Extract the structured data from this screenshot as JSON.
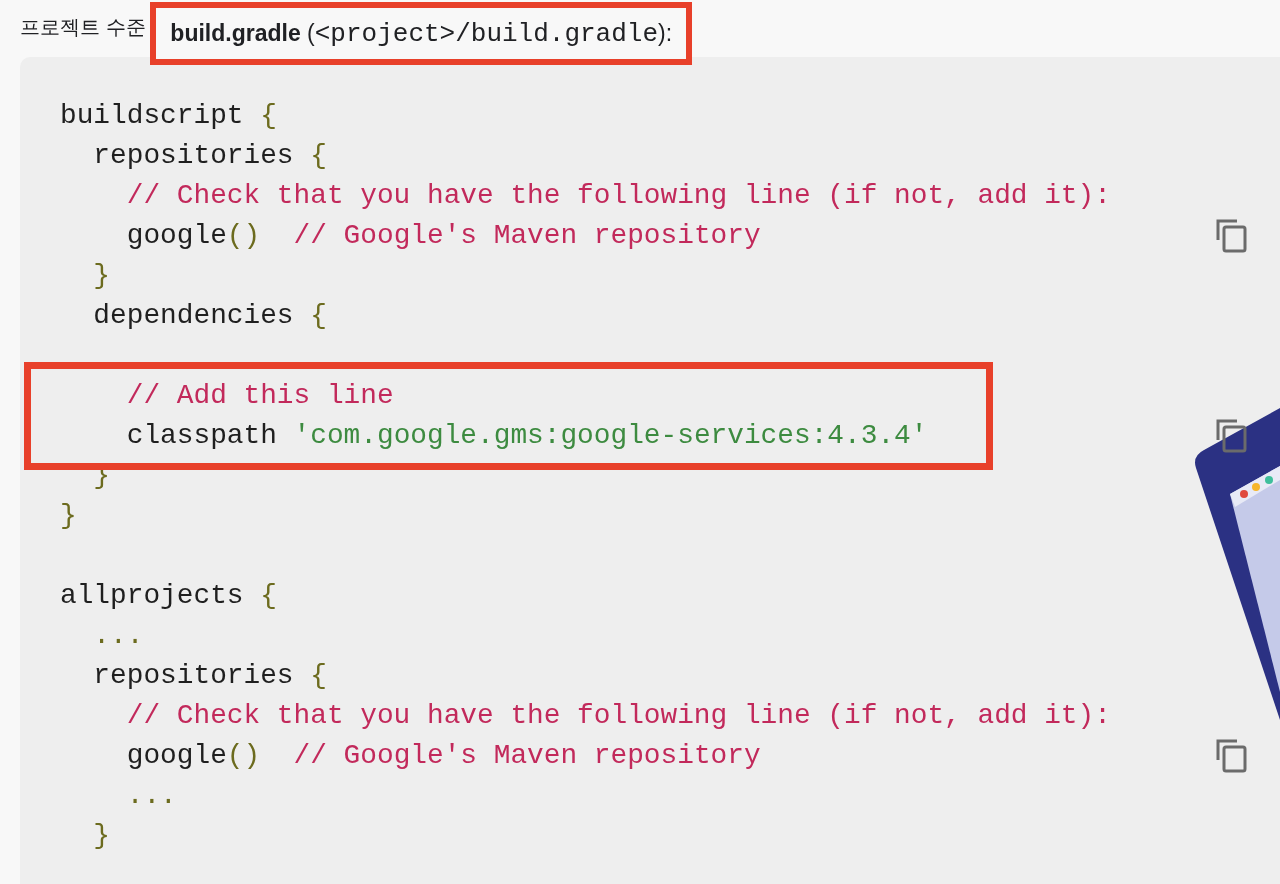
{
  "heading": {
    "text": "프로젝트 수준",
    "file_ref": {
      "file": "build.gradle",
      "open": "(",
      "path": "<project>/build.gradle",
      "close": "):",
      "highlighted": true
    }
  },
  "code": {
    "lines": [
      {
        "kind": "code",
        "tokens": [
          {
            "kind": "plain",
            "text": "buildscript "
          },
          {
            "kind": "punct",
            "text": "{"
          }
        ]
      },
      {
        "kind": "code",
        "tokens": [
          {
            "kind": "plain",
            "text": "  repositories "
          },
          {
            "kind": "punct",
            "text": "{"
          }
        ]
      },
      {
        "kind": "code",
        "tokens": [
          {
            "kind": "comment",
            "text": "    // Check that you have the following line (if not, add it):"
          }
        ]
      },
      {
        "kind": "code",
        "copy": true,
        "tokens": [
          {
            "kind": "plain",
            "text": "    google"
          },
          {
            "kind": "punct",
            "text": "()"
          },
          {
            "kind": "comment",
            "text": "  // Google's Maven repository"
          }
        ]
      },
      {
        "kind": "code",
        "tokens": [
          {
            "kind": "punct",
            "text": "  }"
          }
        ]
      },
      {
        "kind": "code",
        "tokens": [
          {
            "kind": "plain",
            "text": "  dependencies "
          },
          {
            "kind": "punct",
            "text": "{"
          }
        ]
      },
      {
        "kind": "blank"
      },
      {
        "kind": "code",
        "highlighted": true,
        "tokens": [
          {
            "kind": "comment",
            "text": "    // Add this line"
          }
        ]
      },
      {
        "kind": "code",
        "highlighted": true,
        "copy": true,
        "tokens": [
          {
            "kind": "plain",
            "text": "    classpath "
          },
          {
            "kind": "string",
            "text": "'com.google.gms:google-services:4.3.4'"
          }
        ]
      },
      {
        "kind": "code",
        "tokens": [
          {
            "kind": "punct",
            "text": "  }"
          }
        ]
      },
      {
        "kind": "code",
        "tokens": [
          {
            "kind": "punct",
            "text": "}"
          }
        ]
      },
      {
        "kind": "blank"
      },
      {
        "kind": "code",
        "tokens": [
          {
            "kind": "plain",
            "text": "allprojects "
          },
          {
            "kind": "punct",
            "text": "{"
          }
        ]
      },
      {
        "kind": "code",
        "tokens": [
          {
            "kind": "punct",
            "text": "  ..."
          }
        ]
      },
      {
        "kind": "code",
        "tokens": [
          {
            "kind": "plain",
            "text": "  repositories "
          },
          {
            "kind": "punct",
            "text": "{"
          }
        ]
      },
      {
        "kind": "code",
        "tokens": [
          {
            "kind": "comment",
            "text": "    // Check that you have the following line (if not, add it):"
          }
        ]
      },
      {
        "kind": "code",
        "copy": true,
        "tokens": [
          {
            "kind": "plain",
            "text": "    google"
          },
          {
            "kind": "punct",
            "text": "()"
          },
          {
            "kind": "comment",
            "text": "  // Google's Maven repository"
          }
        ]
      },
      {
        "kind": "code",
        "tokens": [
          {
            "kind": "punct",
            "text": "    ..."
          }
        ]
      },
      {
        "kind": "code",
        "tokens": [
          {
            "kind": "punct",
            "text": "  }"
          }
        ]
      }
    ]
  }
}
